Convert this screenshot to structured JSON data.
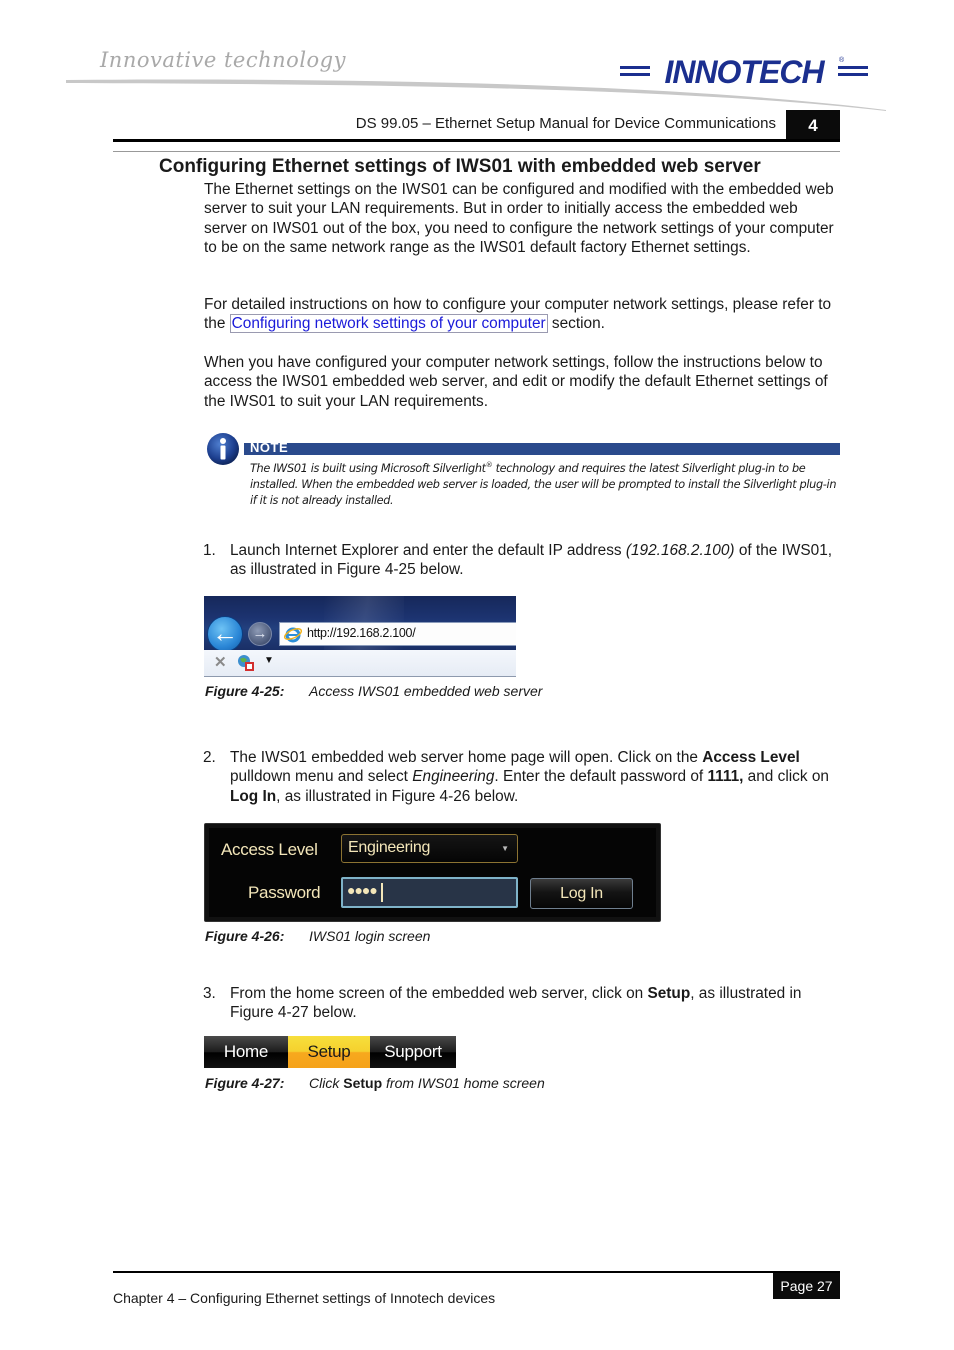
{
  "header": {
    "tagline": "Innovative technology",
    "logo_text": "INNOTECH",
    "logo_mark": "®",
    "doc_title": "DS 99.05 – Ethernet Setup Manual for Device Communications",
    "chapter_number": "4",
    "brand_color": "#1b2f8f"
  },
  "section": {
    "heading": "Configuring Ethernet settings of IWS01 with embedded web server",
    "para1": "The Ethernet settings on the IWS01 can be configured and modified with the embedded web server to suit your LAN requirements.  But in order to initially access the embedded web server on IWS01 out of the box, you need to configure the network settings of your computer to be on the same network range as the IWS01 default factory Ethernet settings.",
    "para2_before": "For detailed instructions on how to configure your computer network settings, please refer to the ",
    "para2_link": "Configuring network settings of your computer",
    "para2_after": " section.",
    "para3": "When you have configured your computer network settings, follow the instructions below to access the IWS01 embedded web server, and edit or modify the default Ethernet settings of the IWS01 to suit your LAN requirements."
  },
  "note": {
    "label": "NOTE",
    "icon": "info-icon",
    "text_1": "The IWS01 is built using Microsoft Silverlight",
    "text_reg": "®",
    "text_2": " technology and requires the latest Silverlight plug-in to be installed.  When the embedded web server is loaded, the user will be prompted to install the Silverlight plug-in if it is not already installed.",
    "bar_color": "#2a4a8c"
  },
  "steps": [
    {
      "number": "1.",
      "t1": "Launch Internet Explorer and enter the default IP address ",
      "t1_italic": "(192.168.2.100)",
      "t2": " of the IWS01, as illustrated in Figure 4-25 below."
    },
    {
      "number": "2.",
      "t1": "The IWS01 embedded web server home page will open.  Click on the ",
      "b1": "Access Level",
      "t2": " pulldown menu and select ",
      "i1": "Engineering",
      "t3": ".  Enter the default password of ",
      "b2": "1111,",
      "t4": " and click on ",
      "b3": "Log In",
      "t5": ", as illustrated in Figure 4-26 below."
    },
    {
      "number": "3.",
      "t1": "From the home screen of the embedded web server, click on ",
      "b1": "Setup",
      "t2": ", as illustrated in Figure 4-27 below."
    }
  ],
  "figures": {
    "browser": {
      "url": "http://192.168.2.100/",
      "back_icon": "back-arrow-icon",
      "forward_icon": "forward-arrow-icon",
      "back_glyph": "←",
      "forward_glyph": "→",
      "stop_glyph": "✕",
      "dropdown_glyph": "▼",
      "caption_num": "Figure 4-25:",
      "caption_text": "Access IWS01 embedded web server"
    },
    "login": {
      "access_level_label": "Access Level",
      "access_level_value": "Engineering",
      "password_label": "Password",
      "password_value": "●●●●",
      "caret_glyph": "▼",
      "login_button": "Log In",
      "caption_num": "Figure 4-26:",
      "caption_text": "IWS01 login screen"
    },
    "nav": {
      "tabs": [
        "Home",
        "Setup",
        "Support"
      ],
      "active_tab": "Setup",
      "caption_num": "Figure 4-27:",
      "caption_pre": "Click ",
      "caption_bold": "Setup",
      "caption_post": " from IWS01 home screen"
    }
  },
  "footer": {
    "chapter_text": "Chapter 4 – Configuring Ethernet settings of Innotech devices",
    "page_label": "Page 27"
  }
}
